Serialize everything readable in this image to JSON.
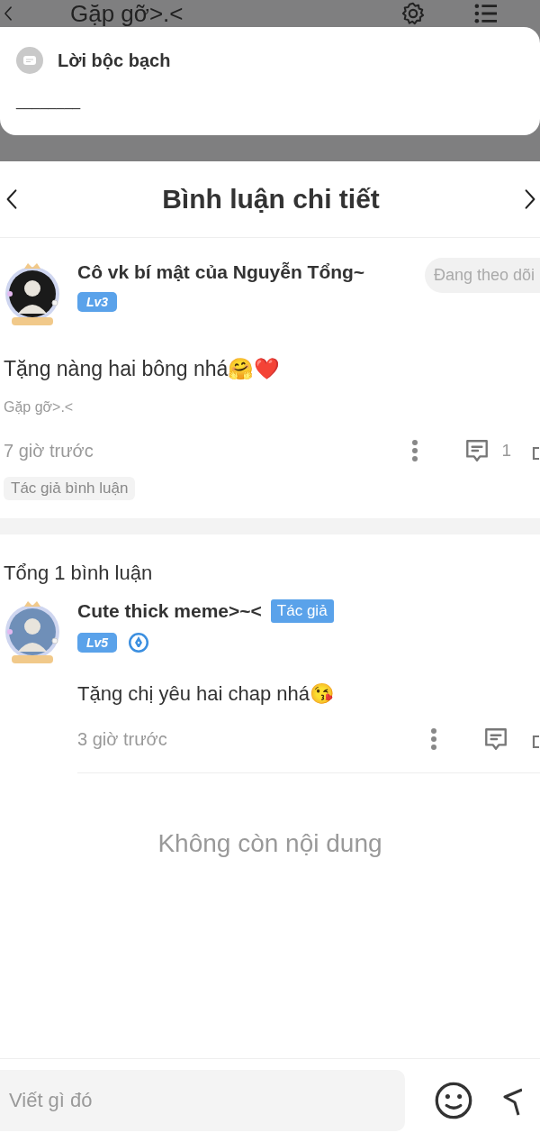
{
  "background_page": {
    "title": "Gặp gỡ>.<"
  },
  "intro_card": {
    "title": "Lời bộc bạch",
    "text": "________"
  },
  "sheet": {
    "title": "Bình luận chi tiết"
  },
  "main_comment": {
    "author": "Cô vk bí mật của Nguyễn Tổng~",
    "level": "Lv3",
    "follow_button": "Đang theo dõi",
    "text": "Tặng nàng hai bông nhá🤗❤️",
    "source": "Gặp gỡ>.<",
    "time": "7 giờ trước",
    "reply_count": "1",
    "tag": "Tác giả bình luận"
  },
  "replies_header": "Tổng 1 bình luận",
  "replies": [
    {
      "author": "Cute thick meme>~<",
      "author_badge": "Tác giả",
      "level": "Lv5",
      "verified": true,
      "text": "Tặng chị yêu hai chap nhá😘",
      "time": "3 giờ trước"
    }
  ],
  "end_text": "Không còn nội dung",
  "composer": {
    "placeholder": "Viết gì đó"
  }
}
